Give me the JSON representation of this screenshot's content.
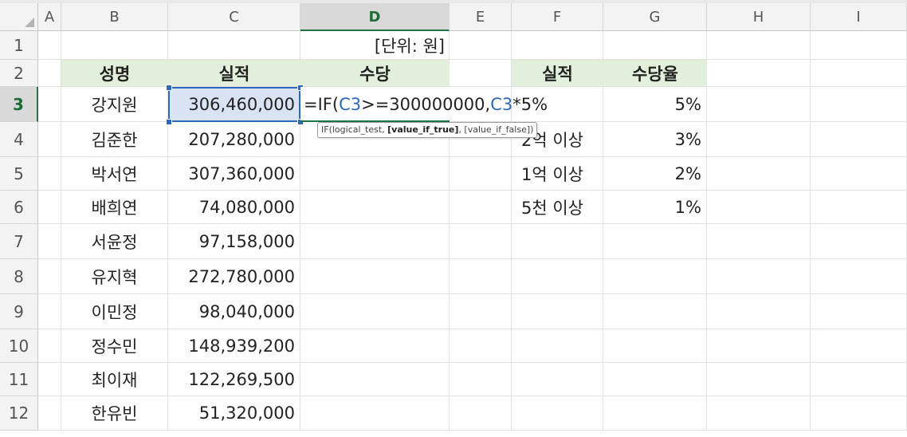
{
  "columns": [
    "A",
    "B",
    "C",
    "D",
    "E",
    "F",
    "G",
    "H",
    "I"
  ],
  "active_column": "D",
  "rows": [
    "1",
    "2",
    "3",
    "4",
    "5",
    "6",
    "7",
    "8",
    "9",
    "10",
    "11",
    "12"
  ],
  "active_row": "3",
  "unit_label": "[단위: 원]",
  "main_table": {
    "headers": [
      "성명",
      "실적",
      "수당"
    ],
    "rows": [
      {
        "name": "강지원",
        "perf": "306,460,000"
      },
      {
        "name": "김준한",
        "perf": "207,280,000"
      },
      {
        "name": "박서연",
        "perf": "307,360,000"
      },
      {
        "name": "배희연",
        "perf": "74,080,000"
      },
      {
        "name": "서윤정",
        "perf": "97,158,000"
      },
      {
        "name": "유지혁",
        "perf": "272,780,000"
      },
      {
        "name": "이민정",
        "perf": "98,040,000"
      },
      {
        "name": "정수민",
        "perf": "148,939,200"
      },
      {
        "name": "최이재",
        "perf": "122,269,500"
      },
      {
        "name": "한유빈",
        "perf": "51,320,000"
      }
    ]
  },
  "rate_table": {
    "headers": [
      "실적",
      "수당율"
    ],
    "rows": [
      {
        "level": "",
        "rate": "5%"
      },
      {
        "level": "2억 이상",
        "rate": "3%"
      },
      {
        "level": "1억 이상",
        "rate": "2%"
      },
      {
        "level": "5천 이상",
        "rate": "1%"
      }
    ]
  },
  "formula": {
    "p1": "=IF(",
    "ref1": "C3",
    "p2": ">=300000000,",
    "ref2": "C3",
    "p3": "*5%"
  },
  "tooltip": {
    "prefix": "IF(logical_test, ",
    "bold": "[value_if_true]",
    "suffix": ", [value_if_false])"
  }
}
